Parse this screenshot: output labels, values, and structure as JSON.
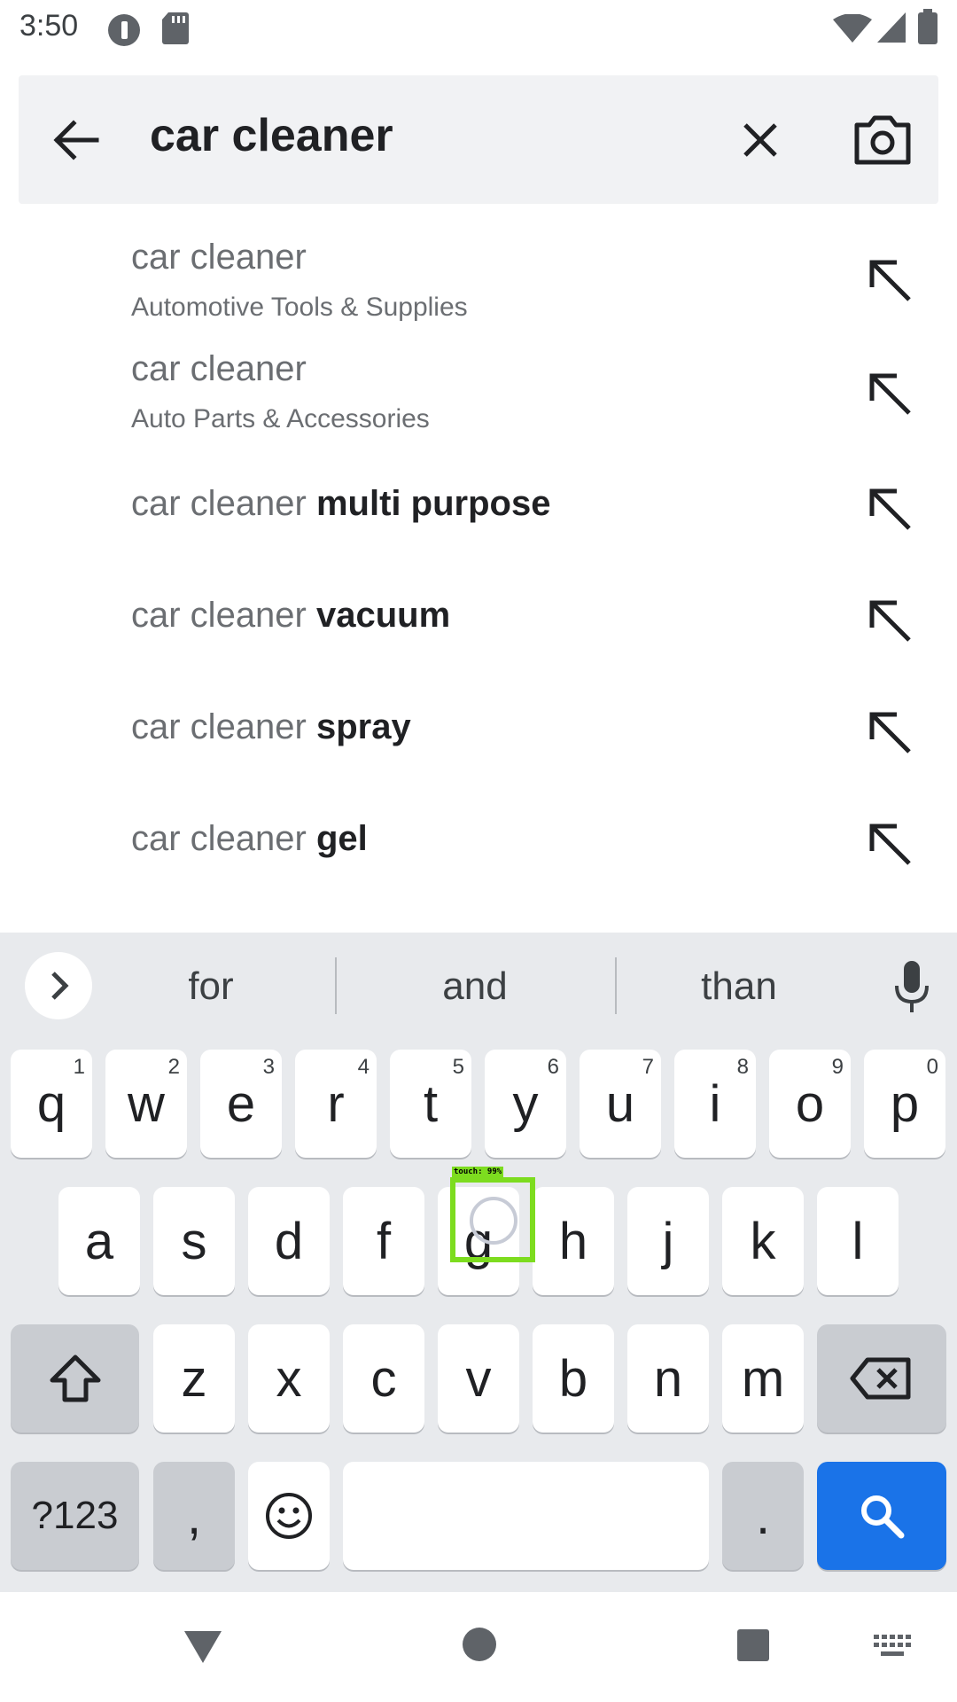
{
  "status_bar": {
    "time": "3:50"
  },
  "search": {
    "query": "car cleaner"
  },
  "suggestions": [
    {
      "plain": "car cleaner",
      "bold": "",
      "subtitle": "Automotive Tools & Supplies"
    },
    {
      "plain": "car cleaner",
      "bold": "",
      "subtitle": "Auto Parts & Accessories"
    },
    {
      "plain": "car cleaner ",
      "bold": "multi purpose",
      "subtitle": ""
    },
    {
      "plain": "car cleaner ",
      "bold": "vacuum",
      "subtitle": ""
    },
    {
      "plain": "car cleaner ",
      "bold": "spray",
      "subtitle": ""
    },
    {
      "plain": "car cleaner ",
      "bold": "gel",
      "subtitle": ""
    }
  ],
  "keyboard": {
    "suggestions": [
      "for",
      "and",
      "than"
    ],
    "row1": [
      {
        "k": "q",
        "h": "1"
      },
      {
        "k": "w",
        "h": "2"
      },
      {
        "k": "e",
        "h": "3"
      },
      {
        "k": "r",
        "h": "4"
      },
      {
        "k": "t",
        "h": "5"
      },
      {
        "k": "y",
        "h": "6"
      },
      {
        "k": "u",
        "h": "7"
      },
      {
        "k": "i",
        "h": "8"
      },
      {
        "k": "o",
        "h": "9"
      },
      {
        "k": "p",
        "h": "0"
      }
    ],
    "row2": [
      "a",
      "s",
      "d",
      "f",
      "g",
      "h",
      "j",
      "k",
      "l"
    ],
    "row3": [
      "z",
      "x",
      "c",
      "v",
      "b",
      "n",
      "m"
    ],
    "symbols_label": "?123",
    "comma": ",",
    "period": ".",
    "touch_label": "touch: 99%"
  },
  "colors": {
    "accent": "#1a73e8",
    "touch_box": "#7ddc1f"
  }
}
